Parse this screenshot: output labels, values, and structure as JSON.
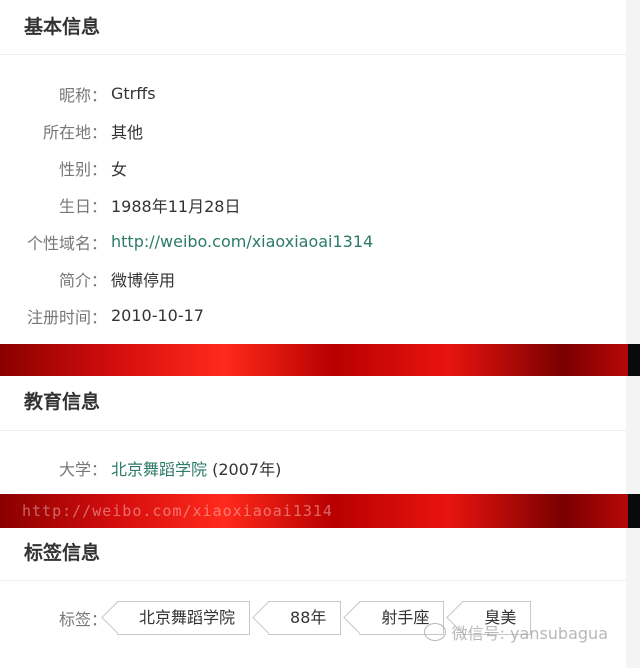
{
  "sections": {
    "basic": {
      "title": "基本信息",
      "rows": [
        {
          "label": "昵称：",
          "value": "Gtrffs"
        },
        {
          "label": "所在地：",
          "value": "其他"
        },
        {
          "label": "性别：",
          "value": "女"
        },
        {
          "label": "生日：",
          "value": "1988年11月28日"
        },
        {
          "label": "个性域名：",
          "value": "http://weibo.com/xiaoxiaoai1314"
        },
        {
          "label": "简介：",
          "value": "微博停用"
        },
        {
          "label": "注册时间：",
          "value": "2010-10-17"
        }
      ]
    },
    "education": {
      "title": "教育信息",
      "label": "大学：",
      "school": "北京舞蹈学院",
      "year": " (2007年)"
    },
    "tags": {
      "title": "标签信息",
      "label": "标签：",
      "items": [
        "北京舞蹈学院",
        "88年",
        "射手座",
        "臭美"
      ]
    }
  },
  "watermarks": {
    "band_text": "http://weibo.com/xiaoxiaoai1314",
    "wechat": "微信号: yansubagua"
  },
  "colors": {
    "link": "#2c7a67",
    "background_band": "#d40d0d"
  }
}
